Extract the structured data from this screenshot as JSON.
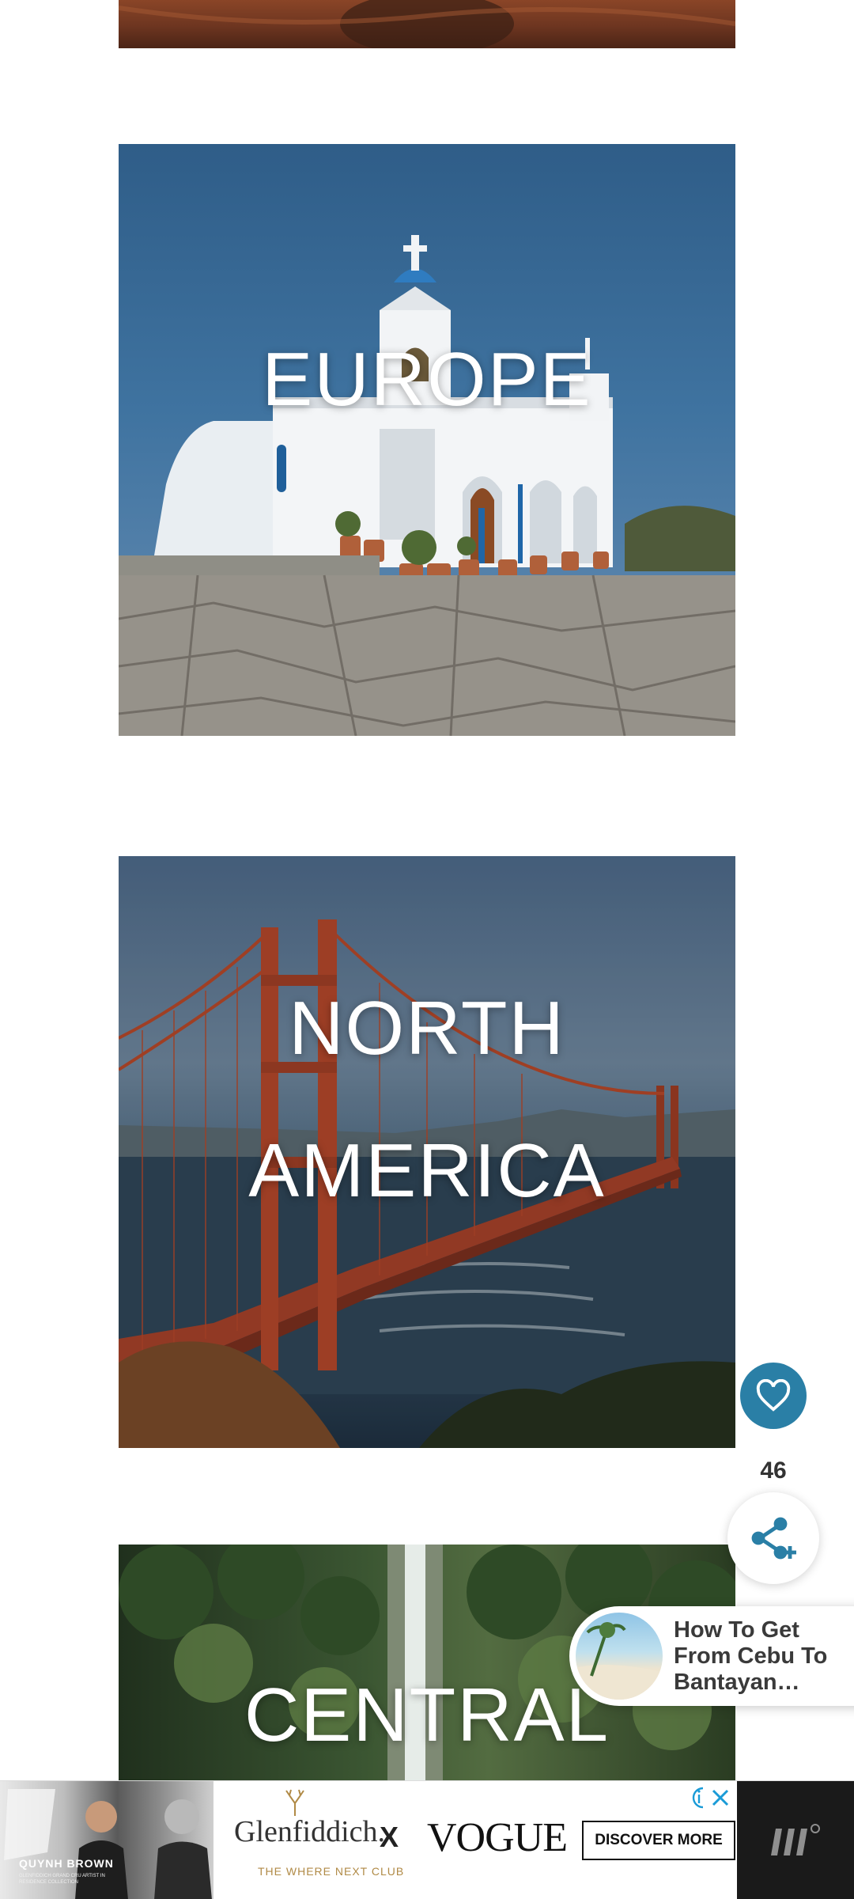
{
  "cards": {
    "europe": {
      "title": "EUROPE"
    },
    "north_america": {
      "title_line1": "NORTH",
      "title_line2": "AMERICA"
    },
    "central": {
      "title": "CENTRAL"
    }
  },
  "floating": {
    "like_count": "46",
    "like_icon": "heart-icon",
    "share_icon": "share-icon"
  },
  "related": {
    "title": "How To Get From Cebu To Bantayan…"
  },
  "ad": {
    "photo_name": "QUYNH BROWN",
    "photo_caption": "GLENFIDDICH GRAND CRU ARTIST IN RESIDENCE COLLECTION",
    "brand_left": "Glenfiddich.",
    "brand_left_tag": "THE WHERE NEXT CLUB",
    "separator": "X",
    "brand_right": "VOGUE",
    "cta": "DISCOVER MORE",
    "colors": {
      "accent": "#2a7fa6",
      "info": "#1a9bd7"
    }
  }
}
